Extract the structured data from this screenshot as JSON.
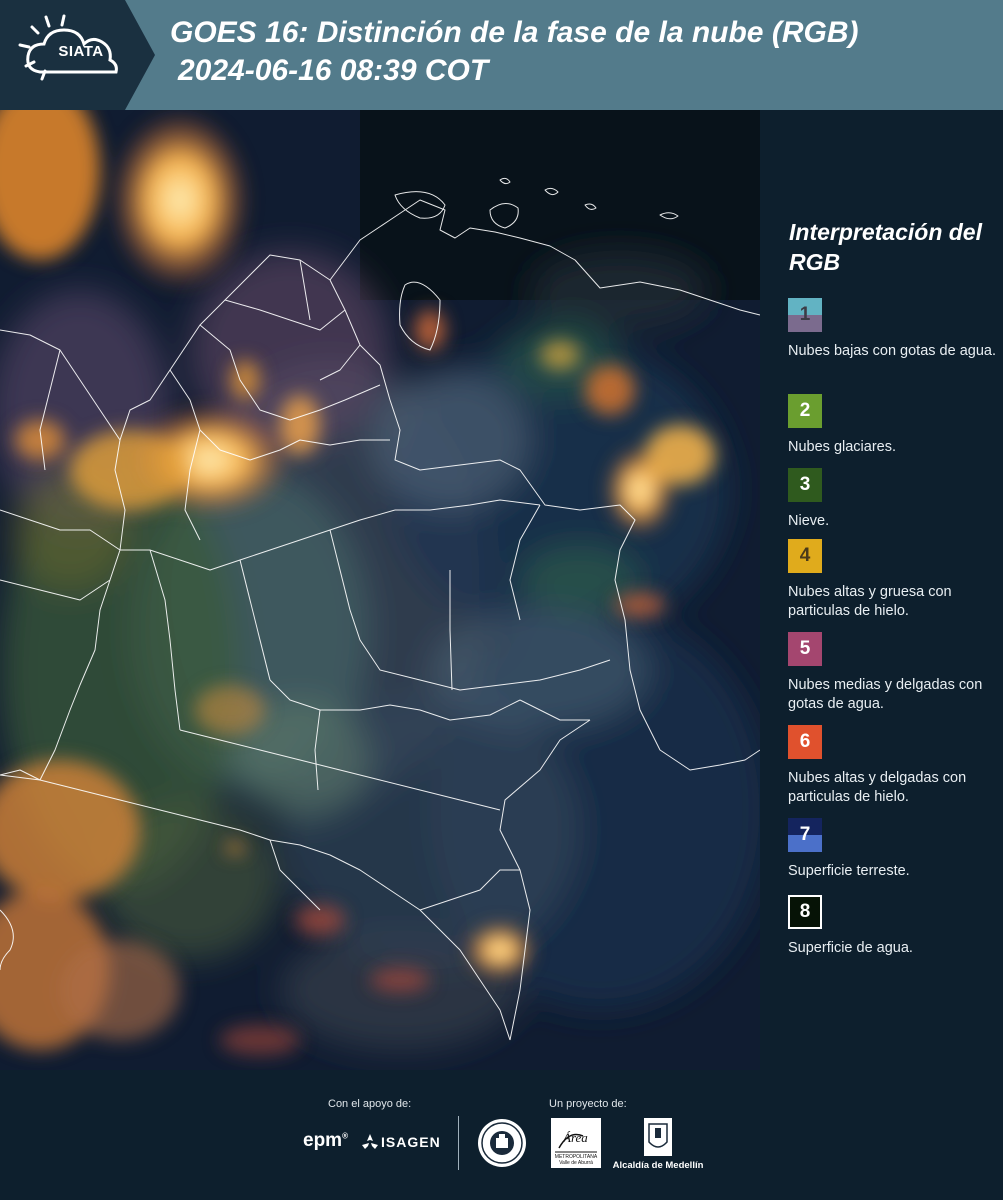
{
  "header": {
    "logo_text": "SIATA",
    "title_line1": "GOES 16: Distinción de la fase de la nube (RGB)",
    "title_line2": "2024-06-16 08:39 COT",
    "background_color": "#537b8b"
  },
  "map": {
    "description_icon": "satellite-rgb-image"
  },
  "legend": {
    "title": "Interpretación del RGB",
    "items": [
      {
        "number": "1",
        "label": "Nubes bajas con gotas de agua.",
        "color_top": "#62b3c3",
        "color_bottom": "#7b6b8e"
      },
      {
        "number": "2",
        "label": "Nubes glaciares.",
        "color": "#6a9e2f"
      },
      {
        "number": "3",
        "label": "Nieve.",
        "color": "#2f5a1e"
      },
      {
        "number": "4",
        "label": "Nubes altas y gruesa con particulas de hielo.",
        "color": "#e0ab1c"
      },
      {
        "number": "5",
        "label": "Nubes medias y delgadas con gotas de agua.",
        "color": "#a4466f"
      },
      {
        "number": "6",
        "label": "Nubes altas y delgadas con particulas de hielo.",
        "color": "#e0512d"
      },
      {
        "number": "7",
        "label": "Superficie terreste.",
        "color_top": "#14245e",
        "color_bottom": "#4b70c9"
      },
      {
        "number": "8",
        "label": "Superficie de agua.",
        "color": "#061306"
      }
    ]
  },
  "footer": {
    "support_label": "Con el apoyo de:",
    "project_label": "Un proyecto de:",
    "epm_text": "epm",
    "epm_mark": "®",
    "isagen_text": "ISAGEN",
    "amva_text_1": "Área",
    "amva_text_2": "METROPOLITANA",
    "amva_text_3": "Valle de Aburrá",
    "alcaldia_text": "Alcaldía de Medellín"
  }
}
